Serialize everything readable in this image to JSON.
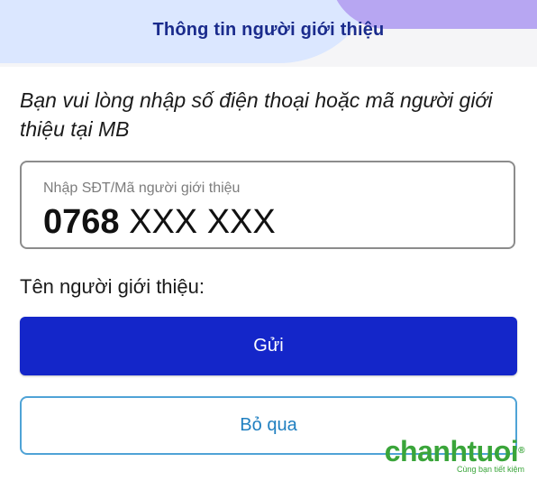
{
  "header": {
    "title": "Thông tin người giới thiệu"
  },
  "instruction": "Bạn vui lòng nhập số điện thoại hoặc mã người giới thiệu tại MB",
  "referral_input": {
    "label": "Nhập SĐT/Mã người giới thiệu",
    "value_prefix": "0768",
    "value_masked": " XXX XXX"
  },
  "referrer_name_label": "Tên người giới thiệu:",
  "buttons": {
    "send": "Gửi",
    "skip": "Bỏ qua"
  },
  "watermark": {
    "logo": "chanhtuoi",
    "registered": "®",
    "tagline": "Cùng bạn tiết kiệm"
  },
  "colors": {
    "header_title": "#1a2b8c",
    "primary_button": "#1426c9",
    "secondary_border": "#4fa3d6",
    "watermark": "#3aa53a"
  }
}
